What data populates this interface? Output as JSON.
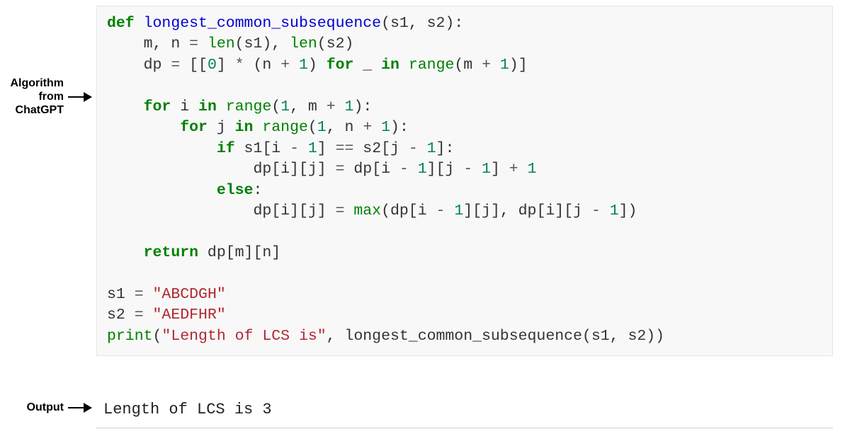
{
  "labels": {
    "algorithm": "Algorithm\nfrom ChatGPT",
    "output": "Output"
  },
  "code": {
    "def": "def",
    "func_name": "longest_common_subsequence",
    "params": "(s1, s2):",
    "line2_a": "m, n ",
    "line2_eq": "=",
    "line2_b": " ",
    "len": "len",
    "line2_c": "(s1), ",
    "line2_d": "(s2)",
    "line3_a": "dp ",
    "line3_b": " [[",
    "zero": "0",
    "line3_c": "] ",
    "star": "*",
    "line3_d": " (n ",
    "plus": "+",
    "one": "1",
    "line3_e": ") ",
    "for": "for",
    "line3_f": " _ ",
    "in": "in",
    "line3_g": " ",
    "range": "range",
    "line3_h": "(m ",
    "line3_i": ")]",
    "line5_a": " i ",
    "line5_b": "(",
    "comma_sp": ", ",
    "line5_c": "m ",
    "line5_d": "):",
    "line6_a": " j ",
    "line6_b": "n ",
    "if": "if",
    "line7_a": " s1[i ",
    "minus": "-",
    "line7_b": "] ",
    "eqeq": "==",
    "line7_c": " s2[j ",
    "line7_d": "]:",
    "line8_a": "dp[i][j] ",
    "line8_b": " dp[i ",
    "line8_c": "][j ",
    "line8_d": "] ",
    "else": "else",
    "colon": ":",
    "line10_a": "dp[i][j] ",
    "max": "max",
    "line10_b": "(dp[i ",
    "line10_c": "][j], dp[i][j ",
    "line10_d": "])",
    "return": "return",
    "line12_a": " dp[m][n]",
    "line14_a": "s1 ",
    "str1": "\"ABCDGH\"",
    "line15_a": "s2 ",
    "str2": "\"AEDFHR\"",
    "print": "print",
    "line16_a": "(",
    "str3": "\"Length of LCS is\"",
    "line16_b": ", longest_common_subsequence(s1, s2))"
  },
  "output_text": "Length of LCS is 3"
}
